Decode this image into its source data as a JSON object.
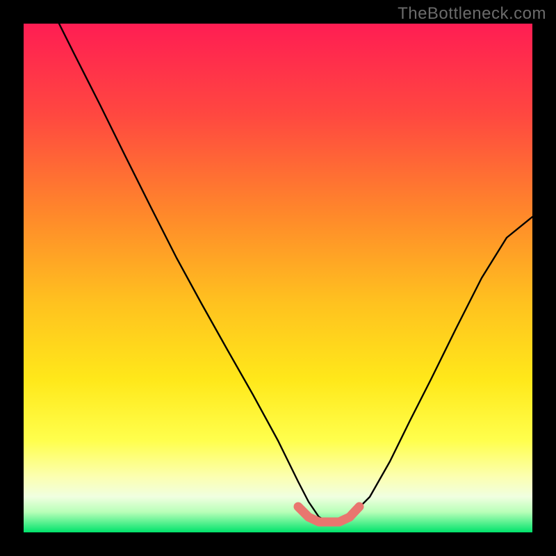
{
  "watermark": "TheBottleneck.com",
  "colors": {
    "frame": "#000000",
    "gradient_top": "#ff1d53",
    "gradient_mid1": "#ff6a2a",
    "gradient_mid2": "#ffd400",
    "gradient_mid3": "#ffff66",
    "gradient_bottom_pale": "#f4ffea",
    "gradient_bottom": "#00e36b",
    "curve": "#000000",
    "pink_segment": "#e9766f"
  },
  "chart_data": {
    "type": "line",
    "title": "",
    "xlabel": "",
    "ylabel": "",
    "xlim": [
      0,
      100
    ],
    "ylim": [
      0,
      100
    ],
    "series": [
      {
        "name": "black-curve",
        "x": [
          7,
          10,
          15,
          20,
          25,
          30,
          35,
          40,
          45,
          50,
          54,
          56,
          58,
          60,
          62,
          64,
          68,
          72,
          76,
          80,
          85,
          90,
          95,
          100
        ],
        "y": [
          100,
          94,
          84,
          74,
          64,
          54,
          45,
          36,
          27,
          18,
          10,
          6,
          3,
          2,
          2,
          3,
          7,
          14,
          22,
          30,
          40,
          50,
          58,
          62
        ]
      },
      {
        "name": "pink-flat-segment",
        "x": [
          54,
          56,
          58,
          60,
          62,
          64,
          66
        ],
        "y": [
          5,
          3,
          2,
          2,
          2,
          3,
          5
        ]
      }
    ]
  }
}
